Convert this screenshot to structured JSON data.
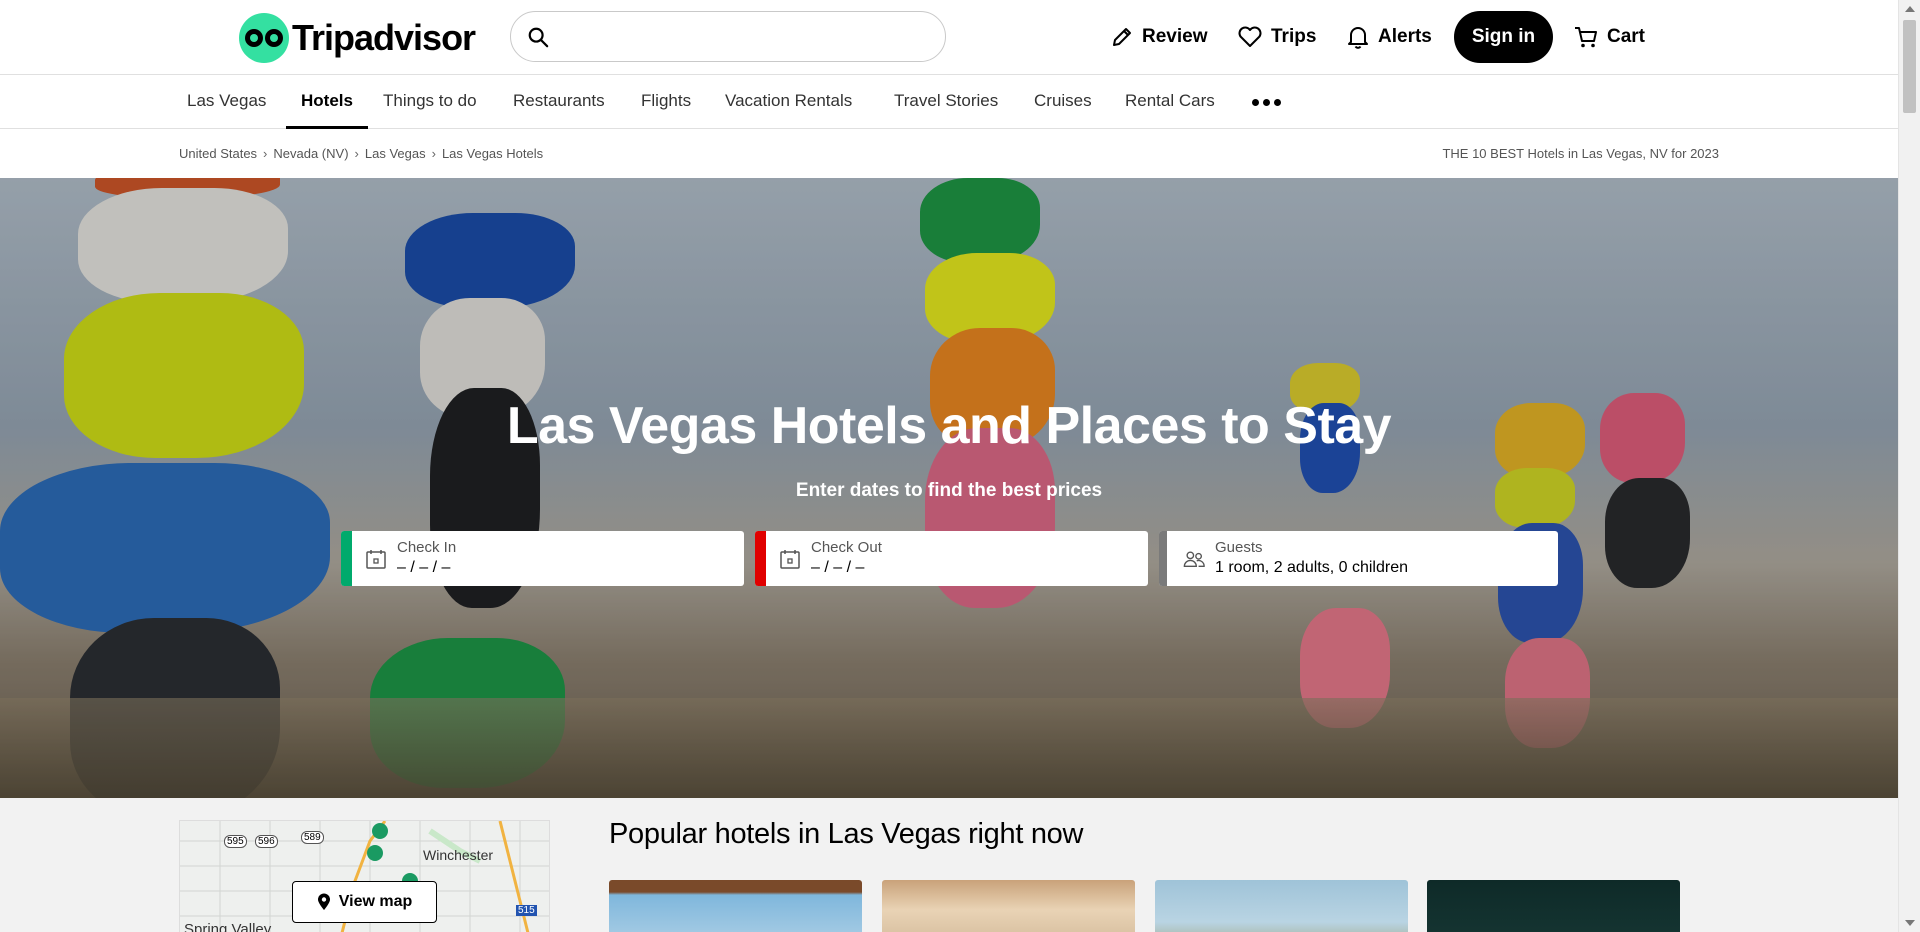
{
  "header": {
    "brand": "Tripadvisor",
    "search": {
      "placeholder": ""
    },
    "review_label": "Review",
    "trips_label": "Trips",
    "alerts_label": "Alerts",
    "signin_label": "Sign in",
    "cart_label": "Cart"
  },
  "tabs": [
    {
      "label": "Las Vegas"
    },
    {
      "label": "Hotels",
      "active": true
    },
    {
      "label": "Things to do"
    },
    {
      "label": "Restaurants"
    },
    {
      "label": "Flights"
    },
    {
      "label": "Vacation Rentals"
    },
    {
      "label": "Travel Stories"
    },
    {
      "label": "Cruises"
    },
    {
      "label": "Rental Cars"
    }
  ],
  "breadcrumb": [
    "United States",
    "Nevada (NV)",
    "Las Vegas",
    "Las Vegas Hotels"
  ],
  "page_heading": "THE 10 BEST Hotels in Las Vegas, NV for 2023",
  "hero": {
    "title": "Las Vegas Hotels and Places to Stay",
    "subtitle": "Enter dates to find the best prices",
    "check_in": {
      "label": "Check In",
      "value": "– / – / –"
    },
    "check_out": {
      "label": "Check Out",
      "value": "– / – / –"
    },
    "guests": {
      "label": "Guests",
      "value": "1 room, 2 adults, 0 children"
    }
  },
  "map": {
    "view_map_label": "View map",
    "place_labels": [
      "Winchester",
      "Spring Valley"
    ],
    "route_shields": [
      "595",
      "596",
      "589",
      "515"
    ]
  },
  "popular": {
    "title": "Popular hotels in Las Vegas right now"
  },
  "colors": {
    "brand_green": "#34e0a1",
    "check_in_accent": "#00aa6c",
    "check_out_accent": "#e00000",
    "guests_accent": "#7a7a7a"
  }
}
